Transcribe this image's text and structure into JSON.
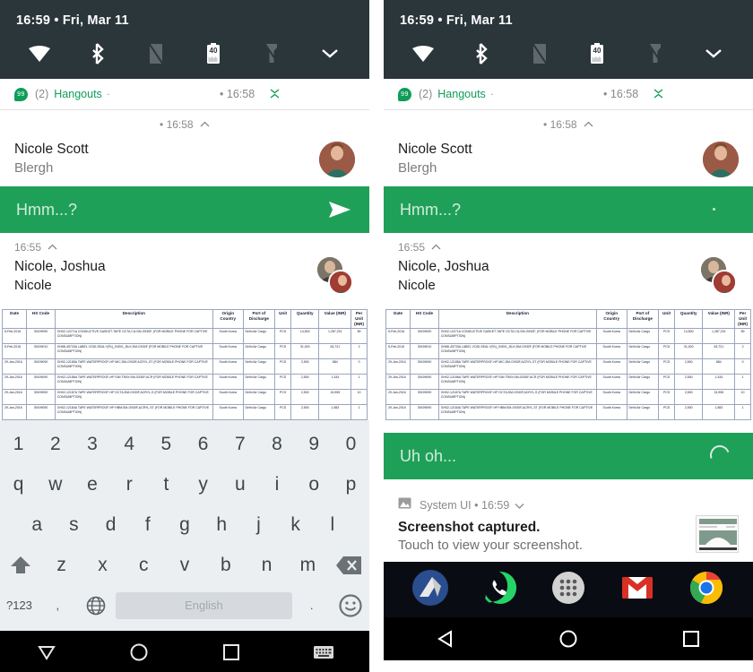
{
  "statusbar": {
    "clock": "16:59",
    "separator": "•",
    "date": "Fri, Mar 11",
    "icons": [
      "wifi-icon",
      "bluetooth-icon",
      "rotation-locked-icon",
      "battery-40-icon",
      "flashlight-off-icon",
      "chevron-down-icon"
    ],
    "battery_level": "40"
  },
  "notification_group": {
    "app_icon": "hangouts-icon",
    "count": "(2)",
    "app_name": "Hangouts",
    "dot": "·",
    "time_prefix": "•",
    "time": "16:58",
    "collapse_icon": "collapse-icon"
  },
  "conversation_1": {
    "time_prefix": "•",
    "time": "16:58",
    "expand_icon": "chevron-up-icon",
    "title": "Nicole Scott",
    "subtitle": "Blergh",
    "avatar": "avatar-nicole"
  },
  "reply_left": {
    "placeholder": "Hmm...?",
    "send_icon": "send-icon"
  },
  "reply_right": {
    "placeholder": "Hmm...?",
    "sending_icon": "sending-dot-icon"
  },
  "conversation_2": {
    "time": "16:55",
    "expand_icon": "chevron-up-icon",
    "title": "Nicole, Joshua",
    "subtitle": "Nicole",
    "avatars": [
      "avatar-joshua",
      "avatar-nicole"
    ]
  },
  "uh_oh_bar": {
    "placeholder": "Uh oh...",
    "status_icon": "loading-spinner-icon"
  },
  "system_notification": {
    "app_icon": "image-icon",
    "app_name": "System UI",
    "separator": "•",
    "time": "16:59",
    "expand_icon": "chevron-down-icon",
    "title": "Screenshot captured.",
    "body": "Touch to view your screenshot.",
    "thumbnail": "screenshot-thumbnail"
  },
  "shipping_table": {
    "headers": [
      "Date",
      "HS Code",
      "Description",
      "Origin Country",
      "Port of Discharge",
      "Unit",
      "Quantity",
      "Value (INR)",
      "Per Unit (INR)"
    ],
    "rows": [
      {
        "date": "5-Feb-2016",
        "hs_code": "39199090",
        "description": "GH02-12271A CONDUCTIVE GASKET-TAPE OCTA CU;SM-G930F, (FOR MOBILE PHONE FOR CAPTIVE CONSUMPTION)",
        "origin_country": "South Korea",
        "port_of_discharge": "Delhi Air Cargo",
        "unit": "PCS",
        "quantity": "14,500",
        "value": "1,287,231",
        "per_unit": "89"
      },
      {
        "date": "5-Feb-2016",
        "hs_code": "39199010",
        "description": "GH68-45733A LABEL VOID-SEAL+(R1)_INSVL_BLK;SM-G930F (FOR MOBILE PHONE FOR CAPTIVE CONSUMPTION)",
        "origin_country": "South Korea",
        "port_of_discharge": "Delhi Air Cargo",
        "unit": "PCS",
        "quantity": "31,000",
        "value": "63,721",
        "per_unit": "2"
      },
      {
        "date": "29-Jan-2016",
        "hs_code": "39199090",
        "description": "GH02-12185A TAPE WATERPROOF-HP MIC;SM-G930F,ACRYL,ST (FOR MOBILE PHONE FOR CAPTIVE CONSUMPTION)",
        "origin_country": "South Korea",
        "port_of_discharge": "Delhi Air Cargo",
        "unit": "PCS",
        "quantity": "2,500",
        "value": "884",
        "per_unit": "0"
      },
      {
        "date": "29-Jan-2016",
        "hs_code": "39199090",
        "description": "GH02-12186A TAPE WATERPROOF-HP SIM TRAY;SM-G930F,ACR (FOR MOBILE PHONE FOR CAPTIVE CONSUMPTION)",
        "origin_country": "South Korea",
        "port_of_discharge": "Delhi Air Cargo",
        "unit": "PCS",
        "quantity": "2,500",
        "value": "1,434",
        "per_unit": "1"
      },
      {
        "date": "29-Jan-2016",
        "hs_code": "39199090",
        "description": "GH02-12187A TAPE WATERPROOF-HP OCTA;SM-G930F,ACRYL,S (FOR MOBILE PHONE FOR CAPTIVE CONSUMPTION)",
        "origin_country": "South Korea",
        "port_of_discharge": "Delhi Air Cargo",
        "unit": "PCS",
        "quantity": "2,500",
        "value": "24,955",
        "per_unit": "10"
      },
      {
        "date": "29-Jan-2016",
        "hs_code": "39199090",
        "description": "GH02-12184A TAPE WATERPROOF-HP HBM;SM-G930F,ACRYL,ST (FOR MOBILE PHONE FOR CAPTIVE CONSUMPTION)",
        "origin_country": "South Korea",
        "port_of_discharge": "Delhi Air Cargo",
        "unit": "PCS",
        "quantity": "2,500",
        "value": "1,583",
        "per_unit": "1"
      }
    ]
  },
  "keyboard": {
    "row_numbers": [
      "1",
      "2",
      "3",
      "4",
      "5",
      "6",
      "7",
      "8",
      "9",
      "0"
    ],
    "row_top": [
      "q",
      "w",
      "e",
      "r",
      "t",
      "y",
      "u",
      "i",
      "o",
      "p"
    ],
    "row_home": [
      "a",
      "s",
      "d",
      "f",
      "g",
      "h",
      "j",
      "k",
      "l"
    ],
    "row_bottom": [
      "z",
      "x",
      "c",
      "v",
      "b",
      "n",
      "m"
    ],
    "shift_icon": "shift-icon",
    "backspace_icon": "backspace-icon",
    "symbols_key": "?123",
    "comma_key": ",",
    "language_icon": "globe-icon",
    "space_label": "English",
    "period_key": ".",
    "emoji_icon": "emoji-icon"
  },
  "navbar_left": {
    "back_icon": "back-triangle-icon",
    "home_icon": "home-circle-icon",
    "recents_icon": "recents-square-icon",
    "keyboard_icon": "keyboard-icon"
  },
  "navbar_right": {
    "back_icon": "back-triangle-icon",
    "home_icon": "home-circle-icon",
    "recents_icon": "recents-square-icon"
  },
  "dock": {
    "items": [
      "news-app-icon",
      "whatsapp-icon",
      "app-drawer-icon",
      "gmail-icon",
      "chrome-icon"
    ]
  },
  "colors": {
    "status_bar_bg": "#2b363b",
    "accent_green": "#1fa058",
    "hangouts_green": "#0f9d58",
    "keyboard_bg": "#eceff1",
    "navbar_bg": "#000000",
    "dock_bg": "#0a0c14"
  }
}
